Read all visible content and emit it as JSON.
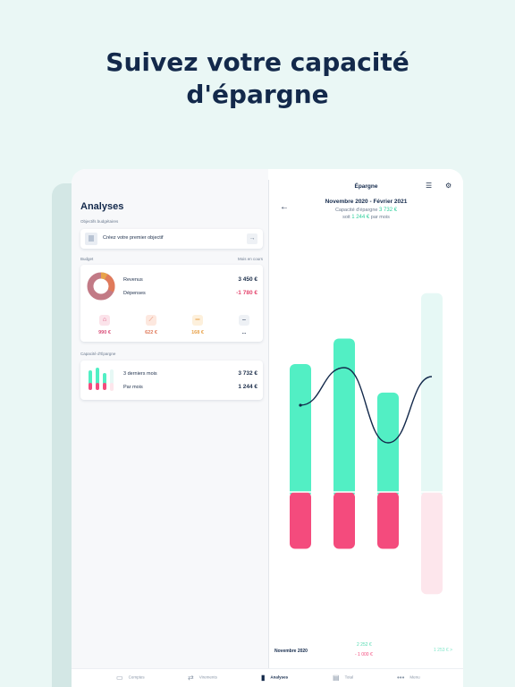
{
  "headline": {
    "line1": "Suivez votre capacité",
    "line2": "d'épargne"
  },
  "left": {
    "title": "Analyses",
    "goals_label": "Objectifs budgétaires",
    "goal_cta": "Créez votre premier objectif",
    "goal_arrow": "→",
    "budget_label": "Budget",
    "budget_period": "Mois en cours",
    "revenus_label": "Revenus",
    "revenus_value": "3 450 €",
    "depenses_label": "Dépenses",
    "depenses_value": "-1 780 €",
    "categories": [
      {
        "amount": "990 €",
        "color": "#d94f7a",
        "bg": "#fbe3ea",
        "icon": "home-icon"
      },
      {
        "amount": "622 €",
        "color": "#e07a5a",
        "bg": "#fde8df",
        "icon": "transport-icon"
      },
      {
        "amount": "168 €",
        "color": "#e8a24a",
        "bg": "#fdf0dc",
        "icon": "food-icon"
      },
      {
        "amount": "...",
        "color": "#1c2e4a",
        "bg": "#eef1f5",
        "icon": "more-icon"
      }
    ],
    "capacity_label": "Capacité d'Épargne",
    "cap_row1_label": "3 derniers mois",
    "cap_row1_value": "3 732 €",
    "cap_row2_label": "Par mois",
    "cap_row2_value": "1 244 €"
  },
  "right": {
    "title": "Épargne",
    "period": "Novembre 2020 - Février 2021",
    "cap_text": "Capacité d'épargne",
    "cap_value": "3 732 €",
    "per_month_pre": "soit",
    "per_month_value": "1 244 €",
    "per_month_post": "par mois",
    "month_label": "Novembre 2020",
    "month_income": "2 252 €",
    "month_expense": "- 1 000 €",
    "next_value": "1 253 €",
    "next_arrow": ">"
  },
  "colors": {
    "income": "#52efc4",
    "expense": "#f44b7d",
    "income_future": "#e6f8f5",
    "expense_future": "#fde6ec",
    "navy": "#13294b"
  },
  "chart_data": {
    "type": "bar",
    "stacked": true,
    "series": [
      {
        "values": [
          2252,
          2700,
          1750,
          3500
        ]
      },
      {
        "values": [
          -1000,
          -1000,
          -1000,
          -1800
        ]
      }
    ],
    "line_values": [
      1252,
      1700,
      750,
      1700
    ],
    "projected_index": 3
  },
  "tabs": [
    {
      "label": "Comptes",
      "icon": "wallet-icon"
    },
    {
      "label": "Virements",
      "icon": "transfer-icon"
    },
    {
      "label": "Analyses",
      "icon": "analytics-icon",
      "active": true
    },
    {
      "label": "Total",
      "icon": "total-icon"
    },
    {
      "label": "Menu",
      "icon": "menu-icon"
    }
  ]
}
